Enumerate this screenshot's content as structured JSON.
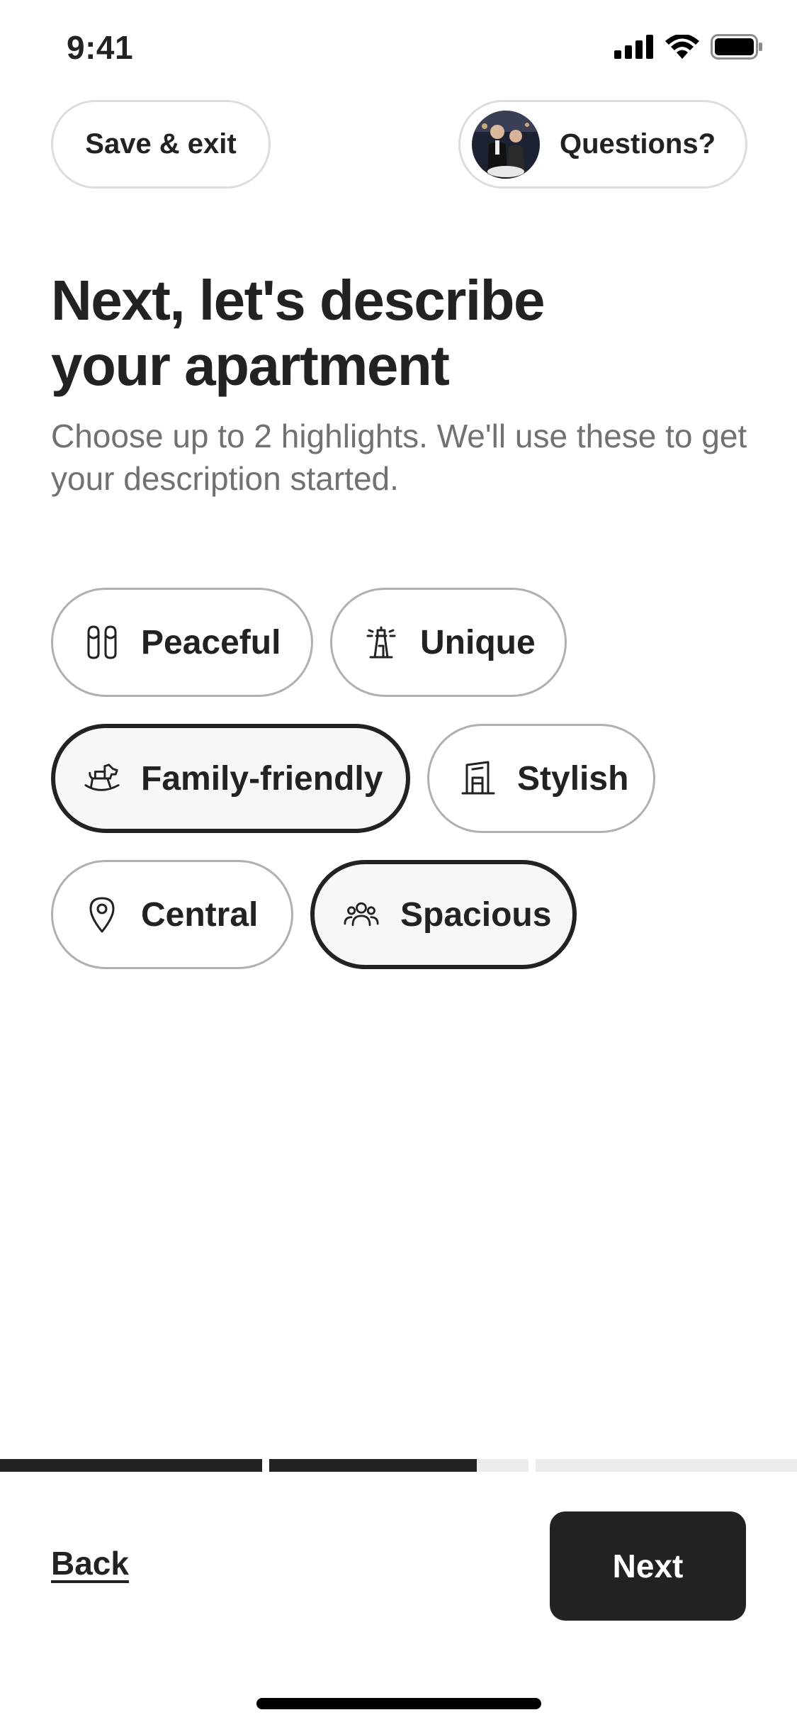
{
  "status_bar": {
    "time": "9:41",
    "icons": [
      "cellular-signal-icon",
      "wifi-icon",
      "battery-icon"
    ]
  },
  "header": {
    "save_exit_label": "Save & exit",
    "questions_label": "Questions?"
  },
  "main": {
    "title": "Next, let's describe your apartment",
    "subtitle": "Choose up to 2 highlights. We'll use these to get your description started.",
    "highlights": [
      {
        "label": "Peaceful",
        "icon": "slippers-icon",
        "selected": false
      },
      {
        "label": "Unique",
        "icon": "lighthouse-icon",
        "selected": false
      },
      {
        "label": "Family-friendly",
        "icon": "rocking-horse-icon",
        "selected": true
      },
      {
        "label": "Stylish",
        "icon": "building-icon",
        "selected": false
      },
      {
        "label": "Central",
        "icon": "map-pin-icon",
        "selected": false
      },
      {
        "label": "Spacious",
        "icon": "people-group-icon",
        "selected": true
      }
    ]
  },
  "progress": {
    "steps": [
      {
        "fraction": 1.0
      },
      {
        "fraction": 0.8
      },
      {
        "fraction": 0.0
      }
    ]
  },
  "footer": {
    "back_label": "Back",
    "next_label": "Next"
  },
  "colors": {
    "primary_text": "#222222",
    "secondary_text": "#717171",
    "selected_border": "#222222",
    "selected_bg": "#f7f7f7",
    "button_bg": "#222222"
  }
}
